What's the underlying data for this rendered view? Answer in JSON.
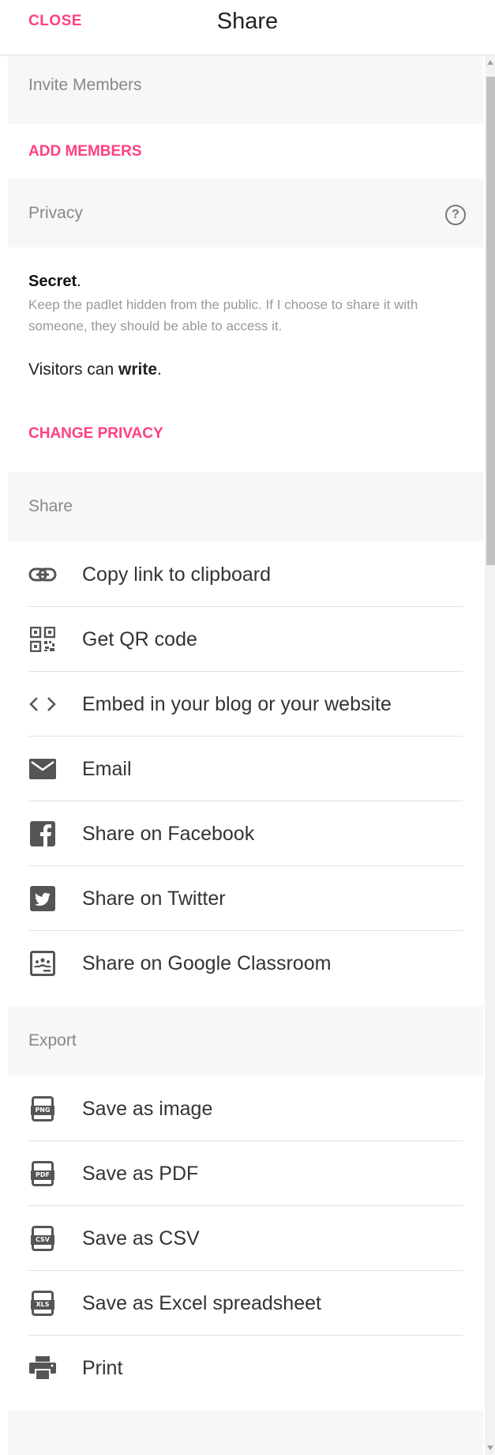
{
  "header": {
    "close_label": "CLOSE",
    "title": "Share"
  },
  "invite": {
    "heading": "Invite Members",
    "add_label": "ADD MEMBERS"
  },
  "privacy": {
    "heading": "Privacy",
    "help_symbol": "?",
    "level": "Secret",
    "level_suffix": ".",
    "description": "Keep the padlet hidden from the public. If I choose to share it with someone, they should be able to access it.",
    "visitors_prefix": "Visitors can ",
    "visitors_permission": "write",
    "visitors_suffix": ".",
    "change_label": "CHANGE PRIVACY"
  },
  "share": {
    "heading": "Share",
    "items": [
      {
        "label": "Copy link to clipboard",
        "icon": "link-icon"
      },
      {
        "label": "Get QR code",
        "icon": "qr-code-icon"
      },
      {
        "label": "Embed in your blog or your website",
        "icon": "code-icon"
      },
      {
        "label": "Email",
        "icon": "email-icon"
      },
      {
        "label": "Share on Facebook",
        "icon": "facebook-icon"
      },
      {
        "label": "Share on Twitter",
        "icon": "twitter-icon"
      },
      {
        "label": "Share on Google Classroom",
        "icon": "google-classroom-icon"
      }
    ]
  },
  "export": {
    "heading": "Export",
    "items": [
      {
        "label": "Save as image",
        "icon": "png-file-icon",
        "badge": "PNG"
      },
      {
        "label": "Save as PDF",
        "icon": "pdf-file-icon",
        "badge": "PDF"
      },
      {
        "label": "Save as CSV",
        "icon": "csv-file-icon",
        "badge": "CSV"
      },
      {
        "label": "Save as Excel spreadsheet",
        "icon": "xls-file-icon",
        "badge": "XLS"
      },
      {
        "label": "Print",
        "icon": "printer-icon"
      }
    ]
  },
  "colors": {
    "accent": "#ff4081",
    "section_background": "#f7f7f7",
    "icon": "#555555"
  }
}
